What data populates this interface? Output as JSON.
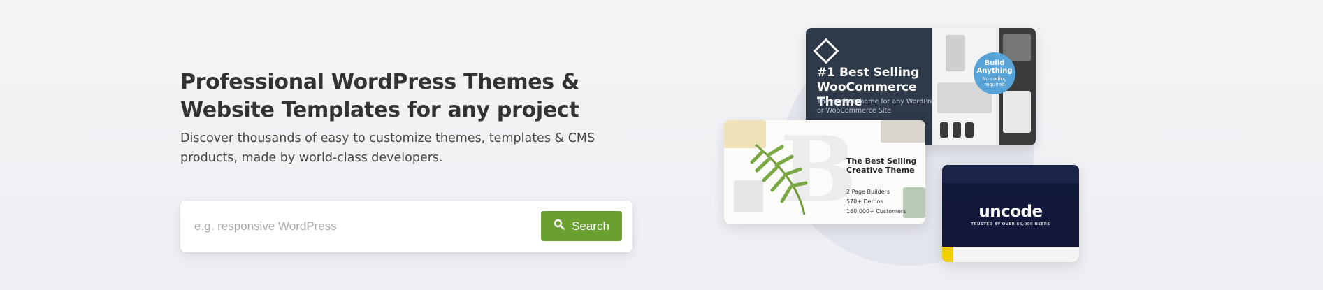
{
  "hero": {
    "headline": "Professional WordPress Themes & Website Templates for any project",
    "subtext": "Discover thousands of easy to customize themes, templates & CMS products, made by world-class developers."
  },
  "search": {
    "placeholder": "e.g. responsive WordPress",
    "value": "",
    "button_label": "Search",
    "button_icon": "search-icon"
  },
  "showcase": {
    "woocommerce_card": {
      "title": "#1 Best Selling WooCommerce Theme",
      "description": "The perfect theme for any WordPress or WooCommerce Site",
      "badge_title": "Build Anything",
      "badge_subtitle": "No coding required"
    },
    "creative_card": {
      "letter": "B",
      "title": "The Best Selling Creative Theme",
      "features": [
        "2 Page Builders",
        "570+ Demos",
        "160,000+ Customers"
      ]
    },
    "uncode_card": {
      "logo": "uncode",
      "tagline": "TRUSTED BY OVER 85,000 USERS"
    }
  },
  "colors": {
    "accent_green": "#69a030",
    "text_dark": "#333333",
    "background": "#f2f3f6",
    "badge_blue": "#58a3d8"
  }
}
